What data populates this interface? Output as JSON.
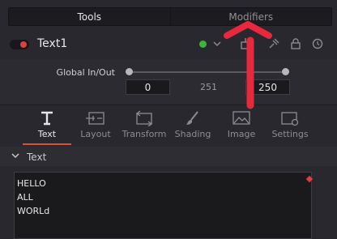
{
  "top_tabs": {
    "tools": "Tools",
    "modifiers": "Modifiers"
  },
  "node": {
    "name": "Text1",
    "enabled": true,
    "status_color": "#3fb33a"
  },
  "global_in_out": {
    "label": "Global In/Out",
    "in": "0",
    "mid": "251",
    "out": "250"
  },
  "inspector_tabs": [
    {
      "label": "Text",
      "icon": "text-tool-icon",
      "active": true
    },
    {
      "label": "Layout",
      "icon": "layout-icon",
      "active": false
    },
    {
      "label": "Transform",
      "icon": "transform-icon",
      "active": false
    },
    {
      "label": "Shading",
      "icon": "brush-icon",
      "active": false
    },
    {
      "label": "Image",
      "icon": "image-icon",
      "active": false
    },
    {
      "label": "Settings",
      "icon": "settings-icon",
      "active": false
    }
  ],
  "section": {
    "title": "Text"
  },
  "styled_text": {
    "lines": [
      "HELLO",
      "ALL",
      "WORLd"
    ]
  },
  "colors": {
    "accent": "#d2543d",
    "keyframe": "#e23c3c",
    "annotation_arrow": "#e8283c"
  }
}
